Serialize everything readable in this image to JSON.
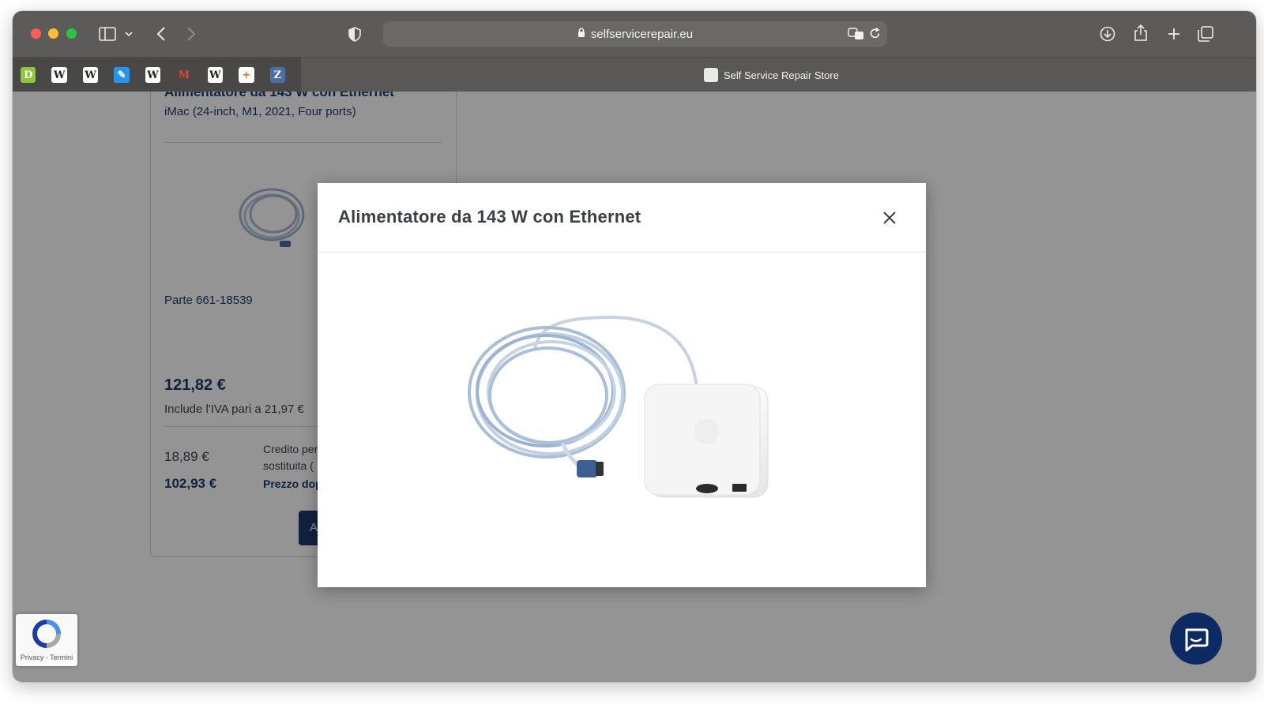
{
  "browser": {
    "url": "selfservicerepair.eu",
    "tab_title": "Self Service Repair Store",
    "favorites": [
      {
        "icon": "d-favicon",
        "glyph": "D",
        "bg": "#8dc63f",
        "fg": "#ffffff"
      },
      {
        "icon": "wikipedia-icon",
        "glyph": "W",
        "bg": "#ffffff",
        "fg": "#222222"
      },
      {
        "icon": "wikipedia-icon",
        "glyph": "W",
        "bg": "#ffffff",
        "fg": "#222222"
      },
      {
        "icon": "pen-favicon",
        "glyph": "✎",
        "bg": "#2196f3",
        "fg": "#ffffff"
      },
      {
        "icon": "wikipedia-icon",
        "glyph": "W",
        "bg": "#ffffff",
        "fg": "#222222"
      },
      {
        "icon": "gmail-icon",
        "glyph": "M",
        "bg": "#4a4847",
        "fg": "#ea4335"
      },
      {
        "icon": "wikipedia-icon",
        "glyph": "W",
        "bg": "#ffffff",
        "fg": "#222222"
      },
      {
        "icon": "plus-favicon",
        "glyph": "+",
        "bg": "#ffffff",
        "fg": "#f26522"
      },
      {
        "icon": "z-favicon",
        "glyph": "Z",
        "bg": "#4a6fa5",
        "fg": "#ffffff"
      }
    ]
  },
  "card": {
    "title": "Alimentatore da 143 W con Ethernet",
    "subtitle": "iMac (24-inch, M1, 2021, Four ports)",
    "part": "Parte 661-18539",
    "price": "121,82 €",
    "vat": "Include l'IVA pari a 21,97 €",
    "credit_value": "18,89 €",
    "credit_label_line1": "Credito per",
    "credit_label_line2": "sostituita (",
    "after_value": "102,93 €",
    "after_label": "Prezzo dop",
    "button_label": "A"
  },
  "modal": {
    "title": "Alimentatore da 143 W con Ethernet",
    "image_alt": "Alimentatore da 143 W con Ethernet"
  },
  "recaptcha": {
    "text": "Privacy - Termini"
  },
  "colors": {
    "brand_navy": "#1d3c6e",
    "chat_button": "#0e2a63"
  }
}
